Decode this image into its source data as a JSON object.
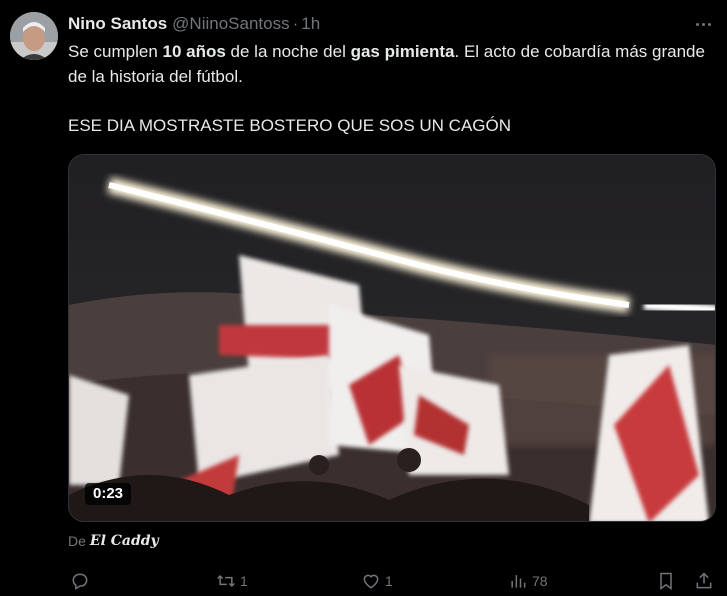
{
  "tweet": {
    "author_name": "Nino Santos",
    "author_handle": "@NiinoSantoss",
    "separator": "·",
    "time": "1h",
    "text": {
      "line1_part1": "Se cumplen ",
      "line1_bold1": "10 años",
      "line1_part2": " de la noche del ",
      "line1_bold2": "gas pimienta",
      "line1_part3": ". El acto de cobardía más grande de la historia del fútbol.",
      "line2": "ESE DIA MOSTRASTE BOSTERO QUE SOS UN CAGÓN"
    },
    "media": {
      "duration": "0:23"
    },
    "source": {
      "prefix": "De",
      "brand": "El Caddy"
    },
    "actions": {
      "reply_icon": "reply-icon",
      "retweet_icon": "retweet-icon",
      "retweet_count": "1",
      "like_icon": "heart-icon",
      "like_count": "1",
      "views_icon": "views-icon",
      "views_count": "78",
      "bookmark_icon": "bookmark-icon",
      "share_icon": "share-icon"
    }
  },
  "colors": {
    "background": "#000000",
    "text": "#e7e9ea",
    "muted": "#71767b",
    "border": "#2f3336"
  }
}
